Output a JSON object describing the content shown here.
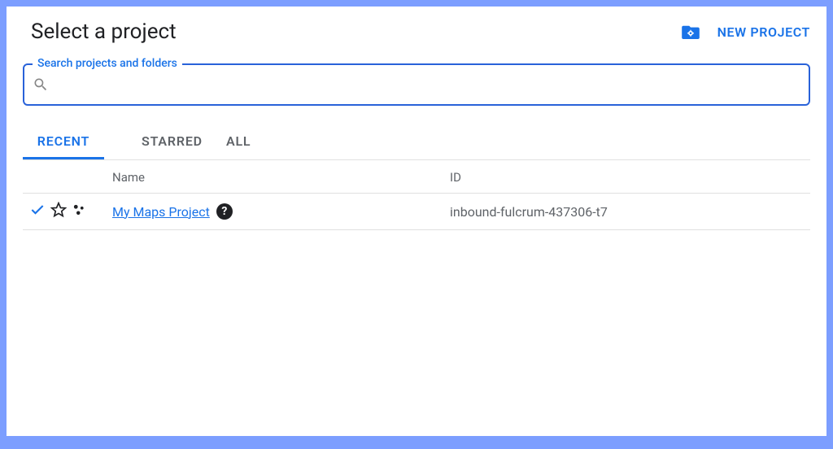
{
  "header": {
    "title": "Select a project",
    "new_project_label": "NEW PROJECT"
  },
  "search": {
    "label": "Search projects and folders",
    "value": ""
  },
  "tabs": {
    "recent": "RECENT",
    "starred": "STARRED",
    "all": "ALL",
    "active": "recent"
  },
  "table": {
    "columns": {
      "name": "Name",
      "id": "ID"
    },
    "rows": [
      {
        "selected": true,
        "starred": false,
        "name": "My Maps Project",
        "id": "inbound-fulcrum-437306-t7"
      }
    ]
  }
}
